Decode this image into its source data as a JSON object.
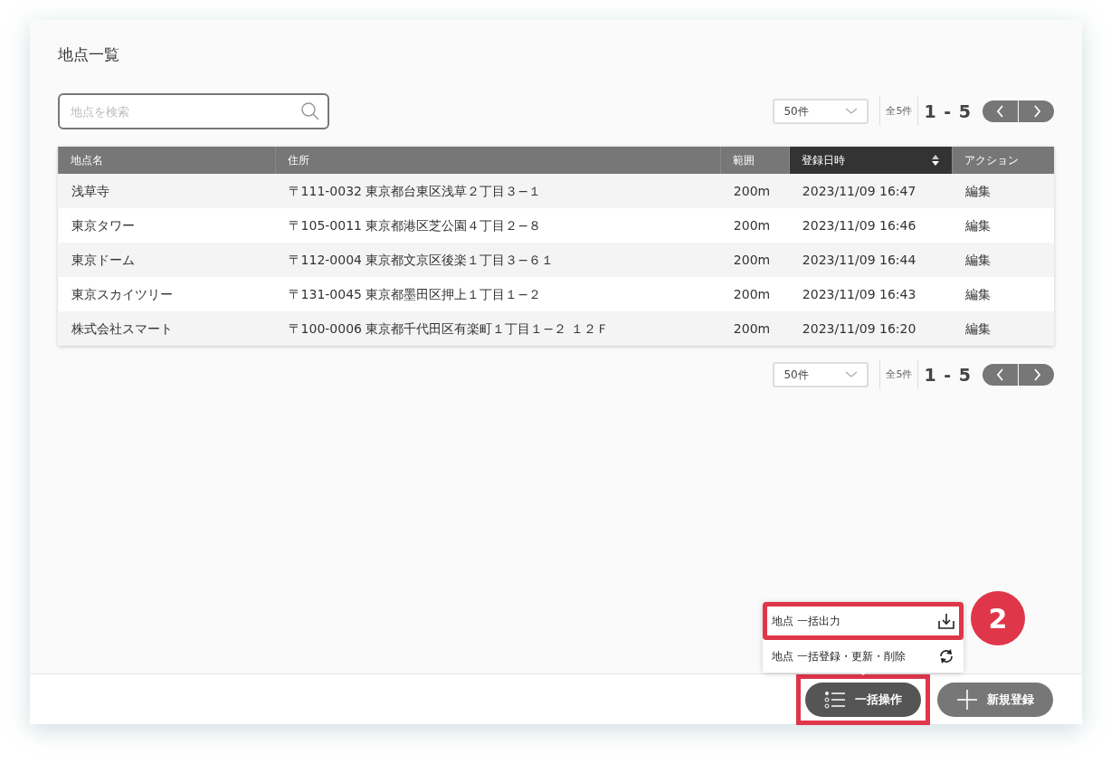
{
  "title": "地点一覧",
  "search": {
    "placeholder": "地点を検索"
  },
  "pagers": [
    {
      "per_page": "50件",
      "total": "全5件",
      "range": "1 - 5"
    },
    {
      "per_page": "50件",
      "total": "全5件",
      "range": "1 - 5"
    }
  ],
  "table": {
    "columns": [
      {
        "label": "地点名",
        "sorted": false
      },
      {
        "label": "住所",
        "sorted": false
      },
      {
        "label": "範囲",
        "sorted": false
      },
      {
        "label": "登録日時",
        "sorted": true
      },
      {
        "label": "アクション",
        "sorted": false
      }
    ],
    "rows": [
      [
        "浅草寺",
        "〒111-0032 東京都台東区浅草２丁目３−１",
        "200m",
        "2023/11/09 16:47",
        "編集"
      ],
      [
        "東京タワー",
        "〒105-0011 東京都港区芝公園４丁目２−８",
        "200m",
        "2023/11/09 16:46",
        "編集"
      ],
      [
        "東京ドーム",
        "〒112-0004 東京都文京区後楽１丁目３−６１",
        "200m",
        "2023/11/09 16:44",
        "編集"
      ],
      [
        "東京スカイツリー",
        "〒131-0045 東京都墨田区押上１丁目１−２",
        "200m",
        "2023/11/09 16:43",
        "編集"
      ],
      [
        "株式会社スマート",
        "〒100-0006 東京都千代田区有楽町１丁目１−２ １２Ｆ",
        "200m",
        "2023/11/09 16:20",
        "編集"
      ]
    ]
  },
  "menu": {
    "items": [
      {
        "kind": "export",
        "label": "地点 一括出力",
        "highlighted": true
      },
      {
        "kind": "import",
        "label": "地点 一括登録・更新・削除",
        "highlighted": false
      }
    ]
  },
  "annotation_badge": "2",
  "footer_buttons": [
    {
      "kind": "bulk",
      "label": "一括操作",
      "highlighted": true
    },
    {
      "kind": "new",
      "label": "新規登録",
      "highlighted": false
    }
  ]
}
